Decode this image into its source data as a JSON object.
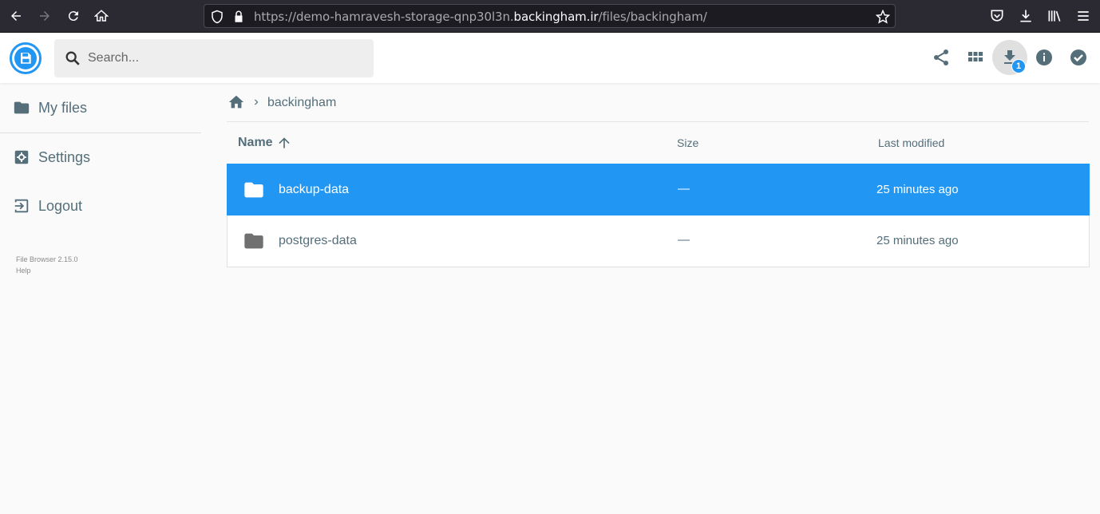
{
  "browser": {
    "url_prefix": "https://demo-hamravesh-storage-qnp30l3n.",
    "url_domain": "backingham.ir",
    "url_suffix": "/files/backingham/"
  },
  "header": {
    "search_placeholder": "Search...",
    "download_badge": "1"
  },
  "sidebar": {
    "items": [
      {
        "label": "My files"
      },
      {
        "label": "Settings"
      },
      {
        "label": "Logout"
      }
    ],
    "version": "File Browser 2.15.0",
    "help": "Help"
  },
  "breadcrumb": {
    "current": "backingham"
  },
  "list": {
    "columns": {
      "name": "Name",
      "size": "Size",
      "modified": "Last modified"
    },
    "rows": [
      {
        "name": "backup-data",
        "size": "—",
        "modified": "25 minutes ago",
        "selected": true
      },
      {
        "name": "postgres-data",
        "size": "—",
        "modified": "25 minutes ago",
        "selected": false
      }
    ]
  },
  "colors": {
    "accent": "#2196f3",
    "text": "#546e7a",
    "browser_bg": "#2b2a33"
  }
}
